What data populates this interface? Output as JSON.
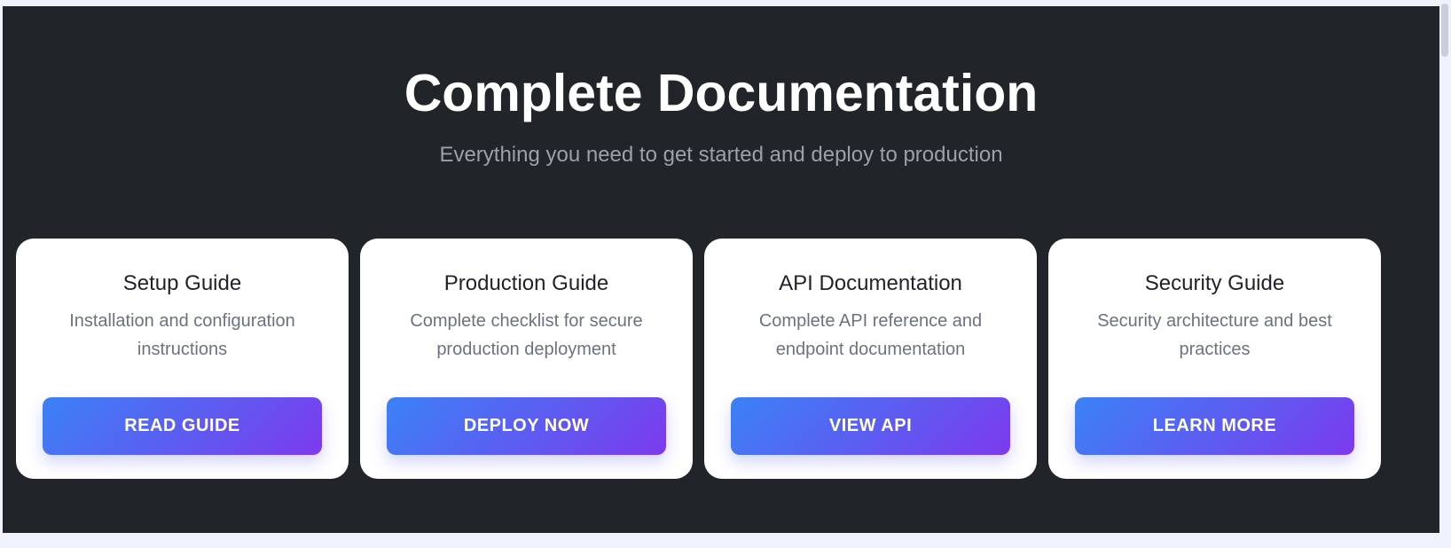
{
  "hero": {
    "title": "Complete Documentation",
    "subtitle": "Everything you need to get started and deploy to production"
  },
  "cards": [
    {
      "title": "Setup Guide",
      "description": "Installation and configuration instructions",
      "button_label": "READ GUIDE"
    },
    {
      "title": "Production Guide",
      "description": "Complete checklist for secure production deployment",
      "button_label": "DEPLOY NOW"
    },
    {
      "title": "API Documentation",
      "description": "Complete API reference and endpoint documentation",
      "button_label": "VIEW API"
    },
    {
      "title": "Security Guide",
      "description": "Security architecture and best practices",
      "button_label": "LEARN MORE"
    }
  ],
  "colors": {
    "section_background": "#212429",
    "page_background": "#eef3fd",
    "button_gradient_start": "#3b82f6",
    "button_gradient_end": "#7c3aed"
  }
}
